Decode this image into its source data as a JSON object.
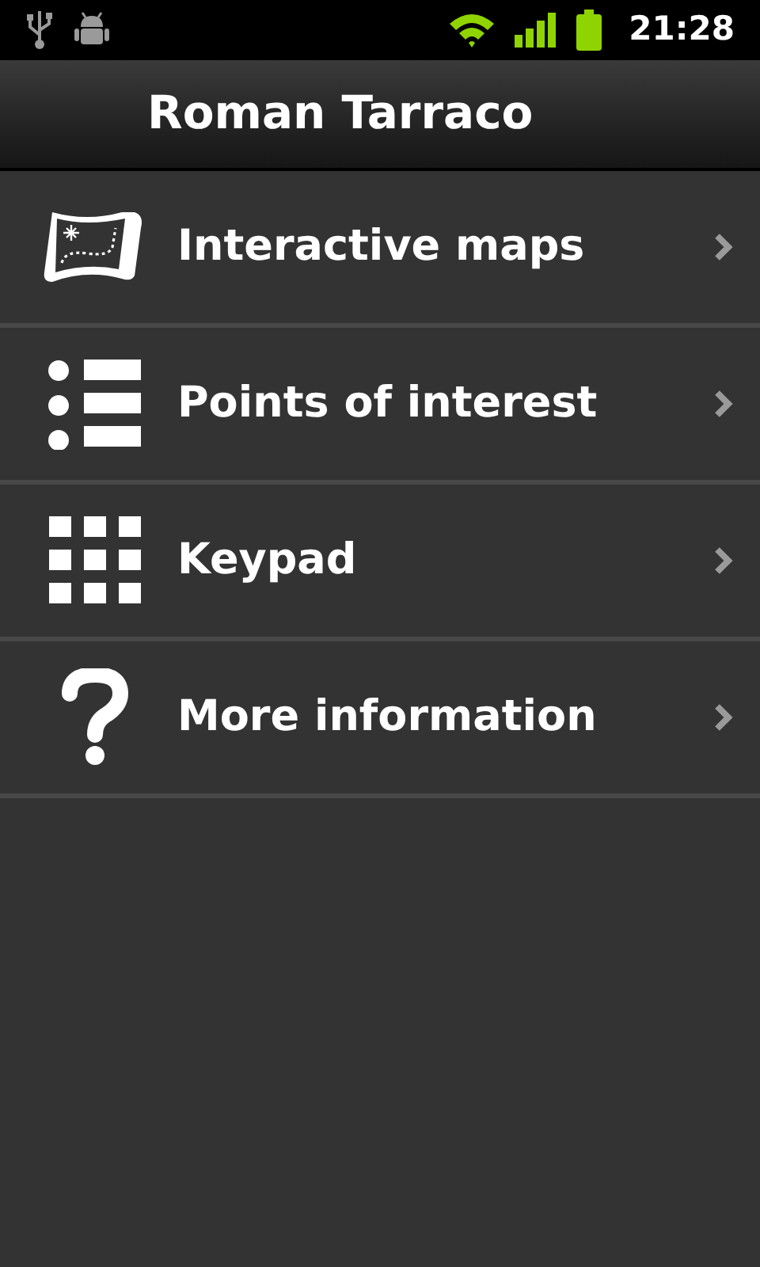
{
  "status_bar": {
    "time": "21:28"
  },
  "header": {
    "title": "Roman Tarraco"
  },
  "menu": [
    {
      "kind": "map",
      "label": "Interactive maps"
    },
    {
      "kind": "list",
      "label": "Points of interest"
    },
    {
      "kind": "keypad",
      "label": "Keypad"
    },
    {
      "kind": "help",
      "label": "More information"
    }
  ]
}
